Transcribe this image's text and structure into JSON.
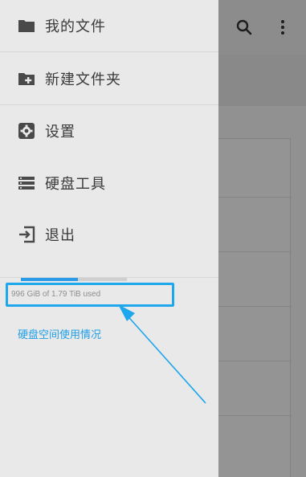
{
  "drawer": {
    "items": [
      {
        "label": "我的文件",
        "icon": "folder-icon"
      },
      {
        "label": "新建文件夹",
        "icon": "folder-add-icon"
      },
      {
        "label": "设置",
        "icon": "gear-icon"
      },
      {
        "label": "硬盘工具",
        "icon": "storage-list-icon"
      },
      {
        "label": "退出",
        "icon": "logout-icon"
      }
    ],
    "storage": {
      "used_text": "996 GiB of 1.79 TiB used",
      "used_fraction": 0.54
    },
    "usage_link": "硬盘空间使用情况"
  },
  "toolbar": {
    "icons": [
      "search-icon",
      "more-vert-icon"
    ]
  },
  "colors": {
    "accent": "#2a9be6",
    "highlight_box": "#1ea7ec",
    "link": "#1f9ee8",
    "icon": "#4a4a4a"
  }
}
